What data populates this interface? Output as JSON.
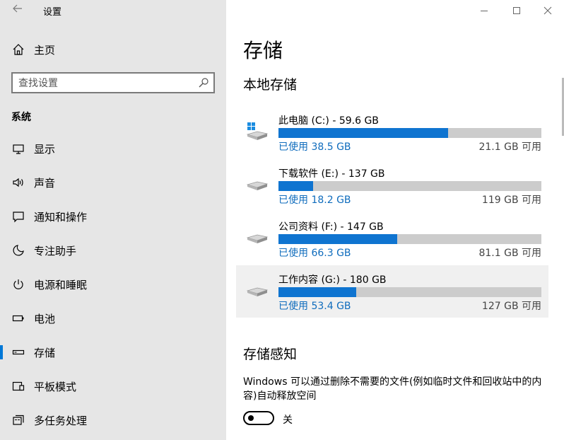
{
  "window": {
    "title": "设置",
    "controls": {
      "minimize": "–",
      "maximize": "☐",
      "close": "✕"
    }
  },
  "sidebar": {
    "home_label": "主页",
    "search_placeholder": "查找设置",
    "section_label": "系统",
    "items": [
      {
        "label": "显示",
        "icon": "monitor-icon"
      },
      {
        "label": "声音",
        "icon": "speaker-icon"
      },
      {
        "label": "通知和操作",
        "icon": "message-icon"
      },
      {
        "label": "专注助手",
        "icon": "moon-icon"
      },
      {
        "label": "电源和睡眠",
        "icon": "power-icon"
      },
      {
        "label": "电池",
        "icon": "battery-icon"
      },
      {
        "label": "存储",
        "icon": "storage-icon",
        "active": true
      },
      {
        "label": "平板模式",
        "icon": "tablet-icon"
      },
      {
        "label": "多任务处理",
        "icon": "multitask-icon"
      }
    ]
  },
  "main": {
    "title": "存储",
    "local_storage_heading": "本地存储",
    "drives": [
      {
        "name": "此电脑 (C:) - 59.6 GB",
        "used": "已使用 38.5 GB",
        "free": "21.1 GB 可用",
        "used_fraction": 0.646,
        "system": true
      },
      {
        "name": "下载软件 (E:) - 137 GB",
        "used": "已使用 18.2 GB",
        "free": "119 GB 可用",
        "used_fraction": 0.133
      },
      {
        "name": "公司资料 (F:) - 147 GB",
        "used": "已使用 66.3 GB",
        "free": "81.1 GB 可用",
        "used_fraction": 0.451
      },
      {
        "name": "工作内容 (G:) - 180 GB",
        "used": "已使用 53.4 GB",
        "free": "127 GB 可用",
        "used_fraction": 0.297,
        "hover": true
      }
    ],
    "storage_sense": {
      "heading": "存储感知",
      "description": "Windows 可以通过删除不需要的文件(例如临时文件和回收站中的内容)自动释放空间",
      "toggle_label": "关",
      "toggle_on": false
    }
  },
  "colors": {
    "accent": "#0078d7",
    "bar_fill": "#0f74d0",
    "bar_bg": "#cccccc",
    "sidebar_bg": "#e6e6e6",
    "used_text": "#0f6cbd"
  }
}
